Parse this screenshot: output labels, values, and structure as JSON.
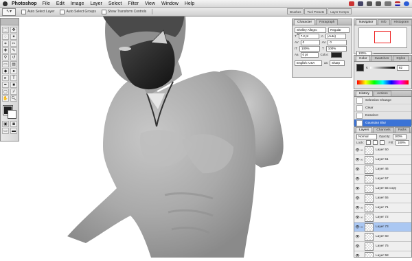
{
  "menubar": {
    "app_name": "Photoshop",
    "items": [
      "File",
      "Edit",
      "Image",
      "Layer",
      "Select",
      "Filter",
      "View",
      "Window",
      "Help"
    ]
  },
  "options_bar": {
    "auto_select_layer": "Auto Select Layer",
    "auto_select_groups": "Auto Select Groups",
    "show_transform_controls": "Show Transform Controls",
    "well_tabs": [
      "Brushes",
      "Tool Presets",
      "Layer Comps"
    ]
  },
  "character_panel": {
    "tabs": [
      "Character",
      "Paragraph"
    ],
    "font_family": "Shelley Allegro Scr...",
    "font_style": "Regular",
    "font_size": "7.2 pt",
    "leading": "(Auto)",
    "kerning": "0",
    "tracking": "0",
    "vertical_scale": "100%",
    "horizontal_scale": "100%",
    "baseline_shift": "0 pt",
    "color_label": "Color:",
    "language": "English: USA",
    "antialias": "Sharp"
  },
  "navigator_panel": {
    "tabs": [
      "Navigator",
      "Info",
      "Histogram"
    ],
    "zoom": "100%"
  },
  "color_panel": {
    "tabs": [
      "Color",
      "Swatches",
      "Styles"
    ],
    "channel_label": "K",
    "value": "82"
  },
  "history_panel": {
    "tabs": [
      "History",
      "Actions"
    ],
    "items": [
      {
        "label": "Selection Change"
      },
      {
        "label": "Clear"
      },
      {
        "label": "Deselect"
      },
      {
        "label": "Gaussian Blur",
        "selected": true
      }
    ]
  },
  "layers_panel": {
    "tabs": [
      "Layers",
      "Channels",
      "Paths"
    ],
    "blend_mode": "Normal",
    "opacity_label": "Opacity:",
    "opacity": "100%",
    "lock_label": "Lock:",
    "fill_label": "Fill:",
    "fill": "100%",
    "layers": [
      {
        "name": "Layer 50",
        "linked": true
      },
      {
        "name": "Layer 51",
        "linked": true
      },
      {
        "name": "Layer 46"
      },
      {
        "name": "Layer 57"
      },
      {
        "name": "Layer 55 copy"
      },
      {
        "name": "Layer 55"
      },
      {
        "name": "Layer 71",
        "linked": true
      },
      {
        "name": "Layer 72",
        "linked": true
      },
      {
        "name": "Layer 73",
        "linked": true,
        "selected": true
      },
      {
        "name": "Layer 60"
      },
      {
        "name": "Layer 75"
      },
      {
        "name": "Layer 58"
      }
    ]
  },
  "colors": {
    "selection": "#3b73d6",
    "layer_selected": "#aac7f2",
    "foreground": "#1f1f1f",
    "background": "#ffffff"
  }
}
